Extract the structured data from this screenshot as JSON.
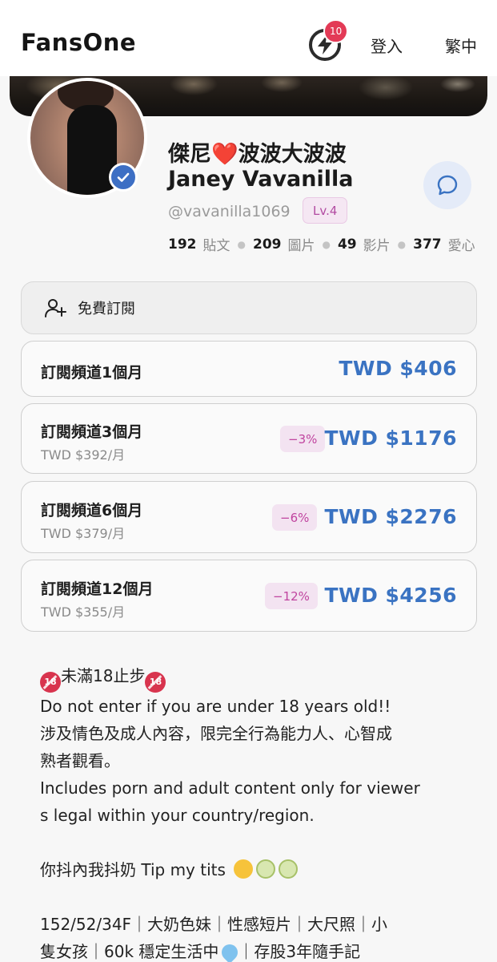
{
  "header": {
    "logo": "FansOne",
    "notification_count": "10",
    "login_label": "登入",
    "language_label": "繁中"
  },
  "profile": {
    "name_zh": "傑尼❤️波波大波波",
    "name_en": "Janey Vavanilla",
    "handle": "@vavanilla1069",
    "level": "Lv.4",
    "stats": [
      {
        "num": "192",
        "label": "貼文"
      },
      {
        "num": "209",
        "label": "圖片"
      },
      {
        "num": "49",
        "label": "影片"
      },
      {
        "num": "377",
        "label": "愛心"
      }
    ]
  },
  "subscription": {
    "free_label": "免費訂閱",
    "plans": [
      {
        "title": "訂閱頻道1個月",
        "per_month": "",
        "discount": "",
        "price": "TWD $406"
      },
      {
        "title": "訂閱頻道3個月",
        "per_month": "TWD $392/月",
        "discount": "−3%",
        "price": "TWD $1176"
      },
      {
        "title": "訂閱頻道6個月",
        "per_month": "TWD $379/月",
        "discount": "−6%",
        "price": "TWD $2276"
      },
      {
        "title": "訂閱頻道12個月",
        "per_month": "TWD $355/月",
        "discount": "−12%",
        "price": "TWD $4256"
      }
    ]
  },
  "bio": {
    "age_warning": "未滿18止步",
    "line_en_1": "Do not enter if you are under 18 years old!!",
    "line_zh_1a": "涉及情色及成人內容，限完全行為能力人、心智成",
    "line_zh_1b": "熟者觀看。",
    "line_en_2a": "Includes porn and adult content only for viewer",
    "line_en_2b": "s legal within your country/region.",
    "tip_line": "你抖內我抖奶 Tip my tits",
    "tags_line_1": "152/52/34F｜大奶色妹｜性感短片｜大尺照｜小",
    "tags_line_2a": "隻女孩｜60k 穩定生活中",
    "tags_line_2b": "｜存股3年隨手記"
  },
  "colors": {
    "accent_blue": "#3a73c2",
    "discount_pink": "#c0449f",
    "badge_red": "#e33a56"
  },
  "icons": {
    "notification": "lightning-bolt-icon",
    "verified": "check-badge-icon",
    "chat": "chat-bubble-icon",
    "free_subscribe": "add-user-icon"
  }
}
